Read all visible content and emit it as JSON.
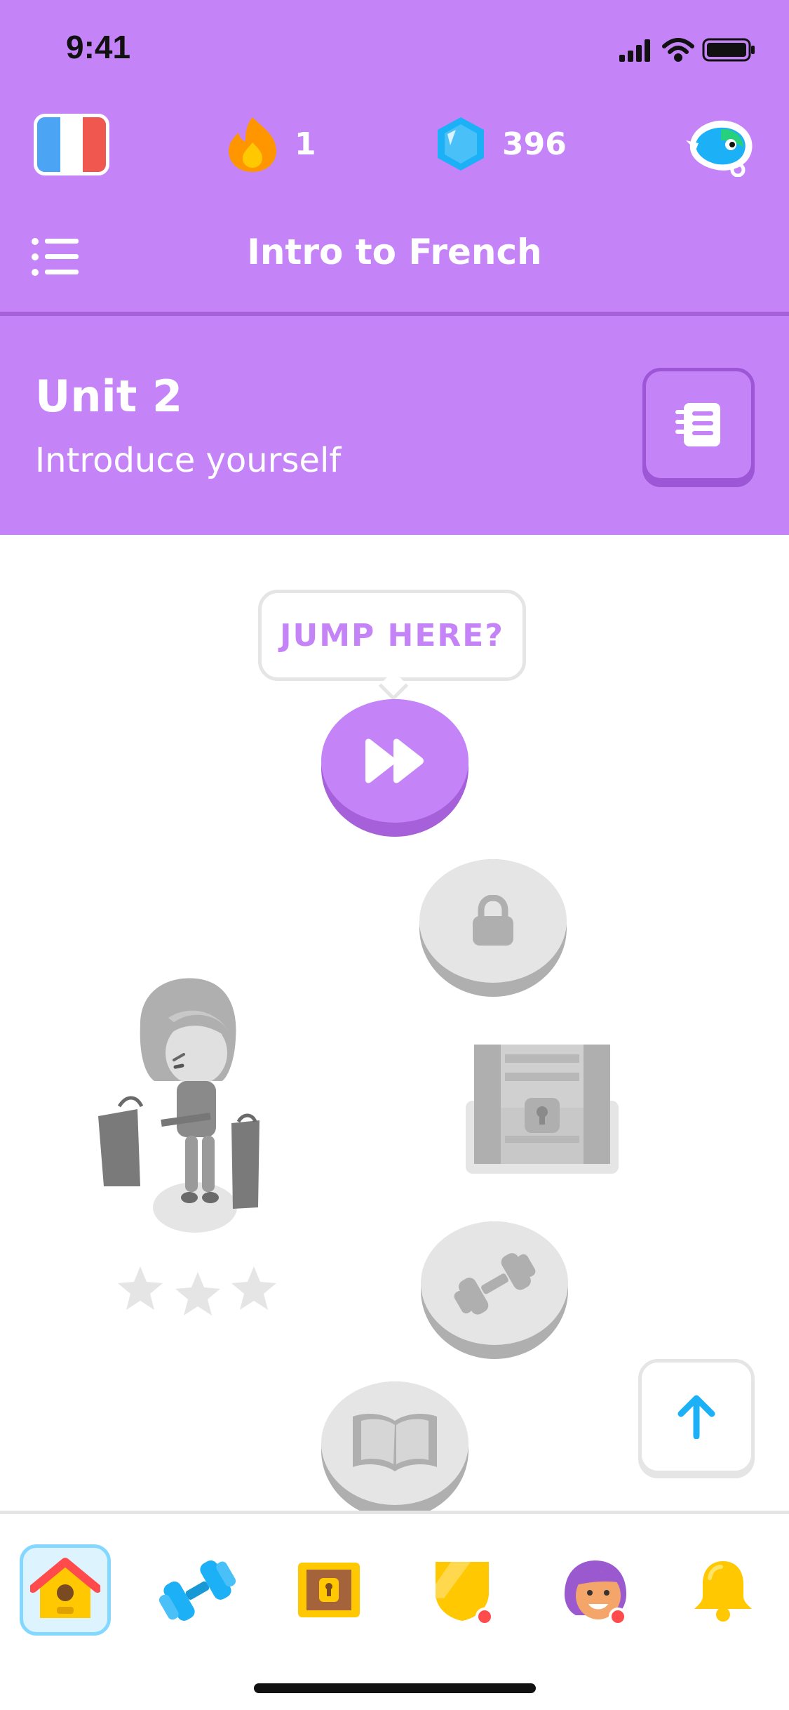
{
  "status_bar": {
    "time": "9:41"
  },
  "stats": {
    "course_flag": "french-flag-icon",
    "streak": "1",
    "gems": "396"
  },
  "header": {
    "title": "Intro to French"
  },
  "unit": {
    "title": "Unit 2",
    "subtitle": "Introduce yourself"
  },
  "path": {
    "tooltip": "JUMP HERE?",
    "nodes": [
      {
        "icon": "fast-forward-icon",
        "state": "active"
      },
      {
        "icon": "lock-icon",
        "state": "locked"
      },
      {
        "icon": "treasure-chest-icon",
        "state": "locked"
      },
      {
        "icon": "dumbbell-icon",
        "state": "locked"
      },
      {
        "icon": "book-icon",
        "state": "locked"
      }
    ]
  },
  "bottom_nav": [
    {
      "icon": "home-icon",
      "active": true
    },
    {
      "icon": "dumbbell-icon",
      "active": false
    },
    {
      "icon": "treasure-chest-icon",
      "active": false
    },
    {
      "icon": "league-shield-icon",
      "active": false,
      "notification": true
    },
    {
      "icon": "profile-avatar-icon",
      "active": false,
      "notification": true
    },
    {
      "icon": "bell-icon",
      "active": false
    }
  ],
  "colors": {
    "header_bg": "#C583F8",
    "accent_dark": "#A560DA",
    "locked_gray": "#E5E5E5",
    "active_tab_bg": "#DDF4FF",
    "blue": "#1CB0F6"
  }
}
